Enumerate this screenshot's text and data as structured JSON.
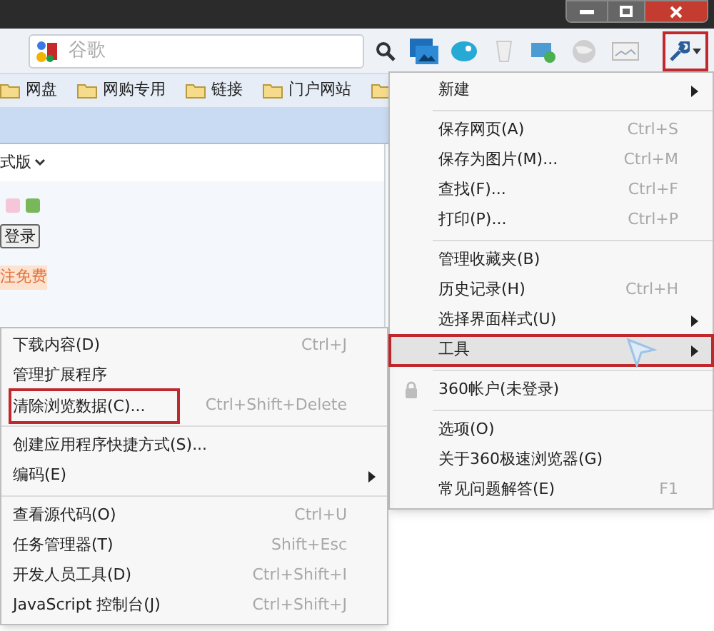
{
  "toolbar": {
    "search": {
      "placeholder": "谷歌"
    },
    "tools_button": {
      "outlined": true
    }
  },
  "bookmarks": [
    {
      "label": "网盘"
    },
    {
      "label": "网购专用"
    },
    {
      "label": "链接"
    },
    {
      "label": "门户网站"
    }
  ],
  "page": {
    "style_link": "式版",
    "login_button": "登录",
    "register_link": "注免费"
  },
  "main_menu": [
    {
      "kind": "item",
      "label": "新建",
      "has_submenu": true,
      "highlighted": false,
      "outlined": false
    },
    {
      "kind": "separator"
    },
    {
      "kind": "item",
      "label": "保存网页(A)",
      "shortcut": "Ctrl+S",
      "has_submenu": false,
      "highlighted": false,
      "outlined": false
    },
    {
      "kind": "item",
      "label": "保存为图片(M)...",
      "shortcut": "Ctrl+M",
      "has_submenu": false,
      "highlighted": false,
      "outlined": false
    },
    {
      "kind": "item",
      "label": "查找(F)...",
      "shortcut": "Ctrl+F",
      "has_submenu": false,
      "highlighted": false,
      "outlined": false
    },
    {
      "kind": "item",
      "label": "打印(P)...",
      "shortcut": "Ctrl+P",
      "has_submenu": false,
      "highlighted": false,
      "outlined": false
    },
    {
      "kind": "separator"
    },
    {
      "kind": "item",
      "label": "管理收藏夹(B)",
      "has_submenu": false,
      "highlighted": false,
      "outlined": false
    },
    {
      "kind": "item",
      "label": "历史记录(H)",
      "shortcut": "Ctrl+H",
      "has_submenu": false,
      "highlighted": false,
      "outlined": false
    },
    {
      "kind": "item",
      "label": "选择界面样式(U)",
      "has_submenu": true,
      "highlighted": false,
      "outlined": false
    },
    {
      "kind": "item",
      "label": "工具",
      "has_submenu": true,
      "highlighted": true,
      "outlined": true
    },
    {
      "kind": "separator"
    },
    {
      "kind": "account",
      "label": "360帐户(未登录)",
      "has_submenu": false,
      "highlighted": false,
      "outlined": false
    },
    {
      "kind": "separator"
    },
    {
      "kind": "item",
      "label": "选项(O)",
      "has_submenu": false,
      "highlighted": false,
      "outlined": false
    },
    {
      "kind": "item",
      "label": "关于360极速浏览器(G)",
      "has_submenu": false,
      "highlighted": false,
      "outlined": false
    },
    {
      "kind": "item",
      "label": "常见问题解答(E)",
      "shortcut": "F1",
      "has_submenu": false,
      "highlighted": false,
      "outlined": false
    }
  ],
  "tools_submenu": [
    {
      "kind": "item",
      "label": "下载内容(D)",
      "shortcut": "Ctrl+J",
      "has_submenu": false,
      "outlined": false
    },
    {
      "kind": "item",
      "label": "管理扩展程序",
      "has_submenu": false,
      "outlined": false
    },
    {
      "kind": "item",
      "label": "清除浏览数据(C)...",
      "shortcut": "Ctrl+Shift+Delete",
      "has_submenu": false,
      "outlined": true
    },
    {
      "kind": "separator"
    },
    {
      "kind": "item",
      "label": "创建应用程序快捷方式(S)...",
      "has_submenu": false,
      "outlined": false
    },
    {
      "kind": "item",
      "label": "编码(E)",
      "has_submenu": true,
      "outlined": false
    },
    {
      "kind": "separator"
    },
    {
      "kind": "item",
      "label": "查看源代码(O)",
      "shortcut": "Ctrl+U",
      "has_submenu": false,
      "outlined": false
    },
    {
      "kind": "item",
      "label": "任务管理器(T)",
      "shortcut": "Shift+Esc",
      "has_submenu": false,
      "outlined": false
    },
    {
      "kind": "item",
      "label": "开发人员工具(D)",
      "shortcut": "Ctrl+Shift+I",
      "has_submenu": false,
      "outlined": false
    },
    {
      "kind": "item",
      "label": "JavaScript 控制台(J)",
      "shortcut": "Ctrl+Shift+J",
      "has_submenu": false,
      "outlined": false
    }
  ]
}
